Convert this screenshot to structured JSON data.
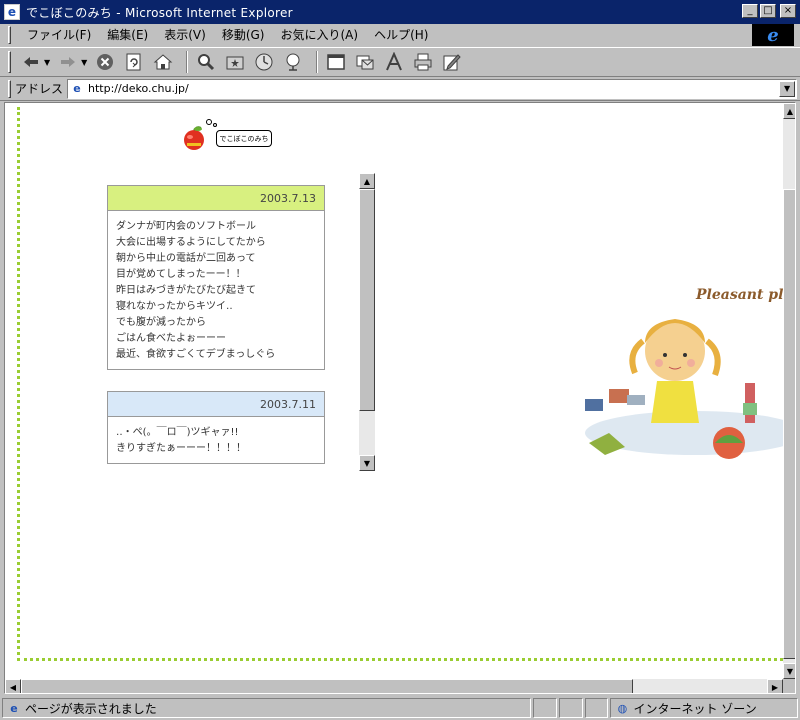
{
  "window": {
    "title": "でこぼこのみち - Microsoft Internet Explorer",
    "app_icon": "ie-page-icon",
    "controls": {
      "minimize": "_",
      "maximize": "□",
      "close": "×"
    }
  },
  "menu": {
    "items": [
      "ファイル(F)",
      "編集(E)",
      "表示(V)",
      "移動(G)",
      "お気に入り(A)",
      "ヘルプ(H)"
    ]
  },
  "toolbar": {
    "buttons": [
      "back-icon",
      "forward-icon",
      "stop-icon",
      "refresh-icon",
      "home-icon",
      "search-icon",
      "favorites-icon",
      "history-icon",
      "channels-icon",
      "fullscreen-icon",
      "mail-icon",
      "font-icon",
      "print-icon",
      "edit-icon"
    ]
  },
  "address": {
    "label": "アドレス",
    "url": "http://deko.chu.jp/"
  },
  "page": {
    "logo_text": "でこぼこのみち",
    "entries": [
      {
        "date": "2003.7.13",
        "header_color": "#d8f080",
        "lines": [
          "ダンナが町内会のソフトボール",
          "大会に出場するようにしてたから",
          "朝から中止の電話が二回あって",
          "目が覚めてしまったーー！！",
          "昨日はみづきがたびたび起きて",
          "寝れなかったからキツイ‥",
          "でも腹が減ったから",
          "ごはん食べたよぉーーー",
          "最近、食欲すごくてデブまっしぐら"
        ]
      },
      {
        "date": "2003.7.11",
        "header_color": "#d8e8f8",
        "lines": [
          "‥・ペ(。￣ロ￣)ツギャァ!!",
          "きりすぎたぁーーー！！！！"
        ]
      }
    ],
    "illustration_text": "Pleasant pla"
  },
  "status": {
    "message": "ページが表示されました",
    "zone": "インターネット ゾーン"
  },
  "colors": {
    "title_bar": "#0a246a",
    "frame_border": "#9acd32",
    "illustration_text": "#8b5a2b"
  }
}
